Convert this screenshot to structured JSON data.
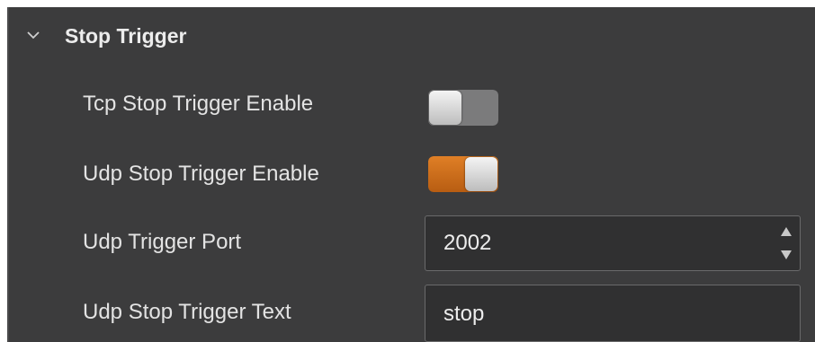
{
  "section": {
    "title": "Stop Trigger",
    "expanded": true,
    "icon": "chevron-down-icon"
  },
  "rows": {
    "tcp_enable": {
      "label": "Tcp Stop Trigger Enable",
      "checked": false
    },
    "udp_enable": {
      "label": "Udp Stop Trigger Enable",
      "checked": true
    },
    "udp_port": {
      "label": "Udp Trigger Port",
      "value": "2002"
    },
    "udp_text": {
      "label": "Udp Stop Trigger Text",
      "value": "stop"
    }
  },
  "colors": {
    "panel_bg": "#3c3c3d",
    "toggle_on": "#d4731d",
    "toggle_off": "#7b7b7c"
  }
}
